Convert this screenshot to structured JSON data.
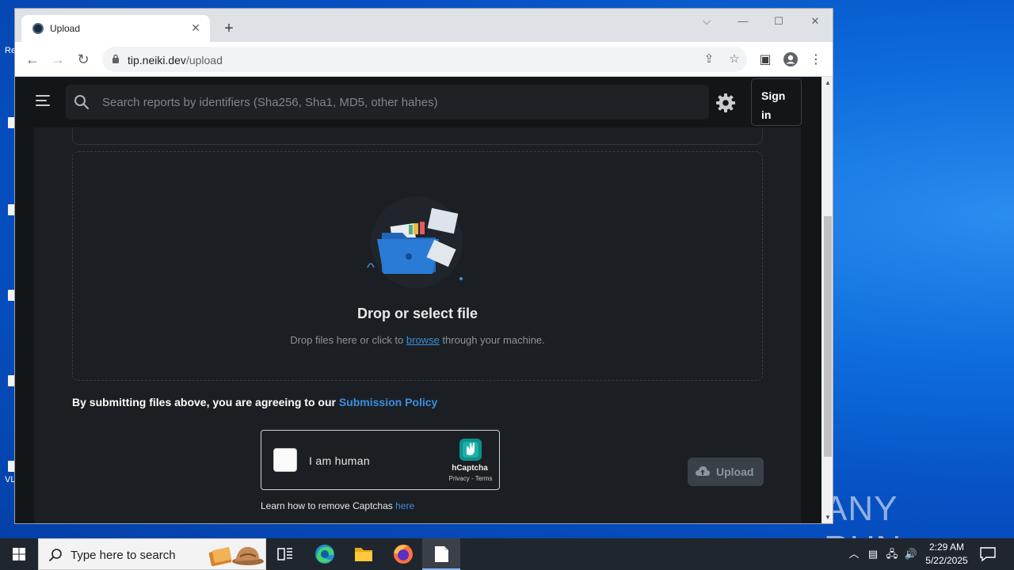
{
  "browser": {
    "tab_title": "Upload",
    "url_host": "tip.neiki.dev",
    "url_path": "/upload"
  },
  "site": {
    "search_placeholder": "Search reports by identifiers (Sha256, Sha1, MD5, other hahes)",
    "signin_label": "Sign in",
    "dropzone_title": "Drop or select file",
    "dropzone_sub_before": "Drop files here or click to ",
    "dropzone_link": "browse",
    "dropzone_sub_after": " through your machine.",
    "policy_text": "By submitting files above, you are agreeing to our ",
    "policy_link": "Submission Policy",
    "captcha_label": "I am human",
    "captcha_brand": "hCaptcha",
    "captcha_privacy": "Privacy - Terms",
    "learn_text": "Learn how to remove Captchas ",
    "learn_link": "here",
    "upload_label": "Upload"
  },
  "taskbar": {
    "search_placeholder": "Type here to search",
    "time": "2:29 AM",
    "date": "5/22/2025"
  },
  "watermark": "ANY RUN",
  "colors": {
    "accent_link": "#3b8fe0",
    "page_bg": "#131619",
    "card_bg": "#1b1f24"
  }
}
